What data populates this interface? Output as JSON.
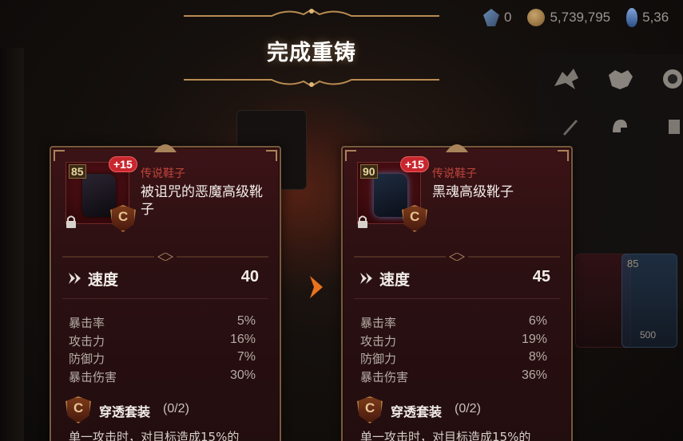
{
  "title": "完成重铸",
  "currencies": [
    {
      "icon": "gem-icon",
      "value": "0"
    },
    {
      "icon": "gold-coin-icon",
      "value": "5,739,795"
    },
    {
      "icon": "blue-crystal-icon",
      "value": "5,36"
    }
  ],
  "side_panel": {
    "card_levels": [
      "85"
    ],
    "card_values": [
      "500"
    ]
  },
  "before": {
    "level": "85",
    "enhance": "+15",
    "type": "传说鞋子",
    "name": "被诅咒的恶魔高级靴子",
    "speed_label": "速度",
    "speed_value": "40",
    "stats": [
      {
        "label": "暴击率",
        "value": "5%"
      },
      {
        "label": "攻击力",
        "value": "16%"
      },
      {
        "label": "防御力",
        "value": "7%"
      },
      {
        "label": "暴击伤害",
        "value": "30%"
      }
    ],
    "set_name": "穿透套装",
    "set_count": "(0/2)",
    "set_desc": "单一攻击时，对目标造成15%的"
  },
  "after": {
    "level": "90",
    "enhance": "+15",
    "type": "传说鞋子",
    "name": "黑魂高级靴子",
    "speed_label": "速度",
    "speed_value": "45",
    "stats": [
      {
        "label": "暴击率",
        "value": "6%"
      },
      {
        "label": "攻击力",
        "value": "19%"
      },
      {
        "label": "防御力",
        "value": "8%"
      },
      {
        "label": "暴击伤害",
        "value": "36%"
      }
    ],
    "set_name": "穿透套装",
    "set_count": "(0/2)",
    "set_desc": "单一攻击时，对目标造成15%的"
  },
  "colors": {
    "accent_gold": "#a9845a",
    "card_bg": "#2b1012",
    "legend_type": "#c0443c",
    "enhance_badge": "#c8262f",
    "arrow": "#e8731c"
  }
}
